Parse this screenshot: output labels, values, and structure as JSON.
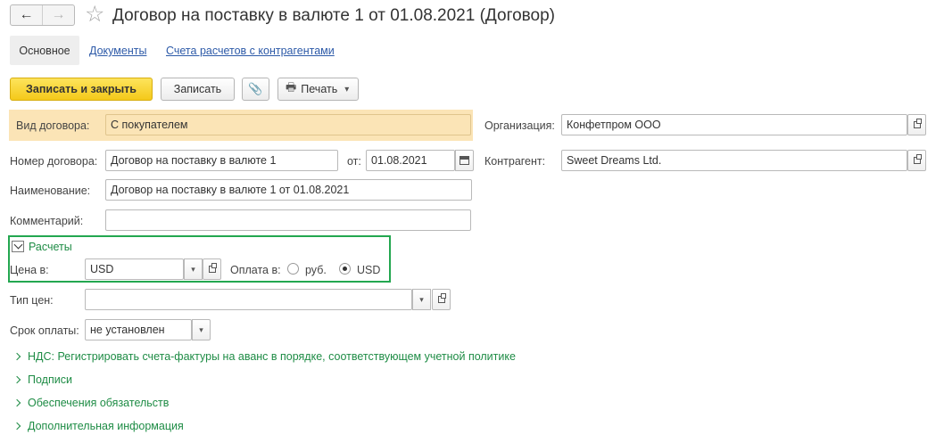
{
  "window": {
    "title": "Договор на поставку в валюте 1 от 01.08.2021 (Договор)",
    "back_glyph": "←",
    "forward_glyph": "→",
    "favorite_glyph": "☆"
  },
  "tabs": [
    {
      "label": "Основное",
      "active": true
    },
    {
      "label": "Документы",
      "active": false
    },
    {
      "label": "Счета расчетов с контрагентами",
      "active": false
    }
  ],
  "toolbar": {
    "save_close_label": "Записать и закрыть",
    "save_label": "Записать",
    "attach_glyph": "📎",
    "print_label": "Печать",
    "print_glyph": "🖶",
    "dropdown_glyph": "▾"
  },
  "form": {
    "contract_type": {
      "label": "Вид договора:",
      "value": "С покупателем"
    },
    "organization": {
      "label": "Организация:",
      "value": "Конфетпром ООО"
    },
    "number": {
      "label": "Номер договора:",
      "value": "Договор на поставку в валюте 1"
    },
    "date": {
      "label": "от:",
      "value": "01.08.2021"
    },
    "counterparty": {
      "label": "Контрагент:",
      "value": "Sweet Dreams Ltd."
    },
    "name": {
      "label": "Наименование:",
      "value": "Договор на поставку в валюте 1 от 01.08.2021"
    },
    "comment": {
      "label": "Комментарий:",
      "value": ""
    },
    "settlements": {
      "title": "Расчеты",
      "price_in_label": "Цена в:",
      "price_in_value": "USD",
      "payment_label": "Оплата в:",
      "payment_options": [
        {
          "label": "руб.",
          "selected": false
        },
        {
          "label": "USD",
          "selected": true
        }
      ]
    },
    "price_type": {
      "label": "Тип цен:",
      "value": ""
    },
    "payment_term": {
      "label": "Срок оплаты:",
      "value": "не установлен"
    }
  },
  "collapsed_sections": [
    "НДС: Регистрировать счета-фактуры на аванс в порядке, соответствующем учетной политике",
    "Подписи",
    "Обеспечения обязательств",
    "Дополнительная информация"
  ],
  "colors": {
    "accent_green": "#23a750",
    "highlight": "#fbe4b6",
    "primary_button": "#f4c91a",
    "link": "#2d5aa8"
  }
}
